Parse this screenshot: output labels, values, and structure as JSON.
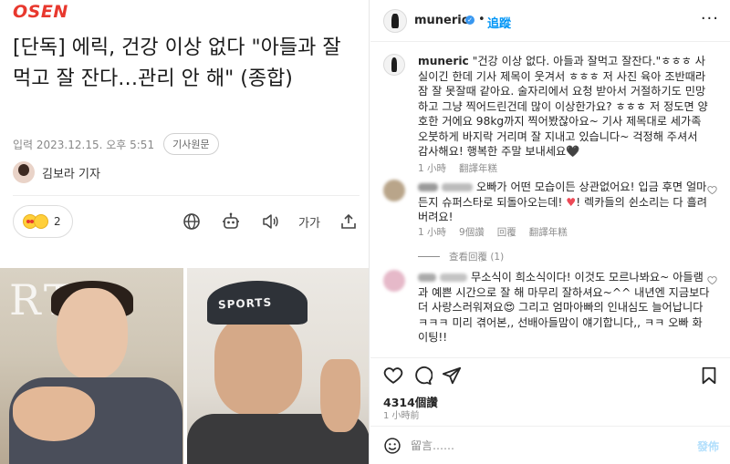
{
  "article": {
    "logo": "OSEN",
    "headline": "[단독] 에릭, 건강 이상 없다 \"아들과 잘 먹고 잘 잔다…관리 안 해\" (종합)",
    "date": "입력 2023.12.15. 오후 5:51",
    "source_button": "기사원문",
    "reporter": "김보라 기자",
    "reaction_count": "2",
    "font_icon_label": "가가",
    "photo_left_text": "RT",
    "photo_right_cap_text": "SPORTS",
    "icons": [
      "globe-icon",
      "robot-icon",
      "speaker-icon",
      "font-size-icon",
      "share-icon"
    ]
  },
  "instagram": {
    "username": "muneric",
    "separator": "•",
    "follow": "追蹤",
    "more": "···",
    "caption": {
      "username": "muneric",
      "text": "\"건강 이상 없다. 아들과 잘먹고 잘잔다.\"ㅎㅎㅎ 사실이긴 한데 기사 제목이 웃겨서 ㅎㅎㅎ 저 사진 육아 조반때라 잠 잘 못잘때 같아요. 술자리에서 요청 받아서 거절하기도 민망하고 그냥 찍어드린건데 많이 이상한가요? ㅎㅎㅎ 저 정도면 양호한 거에요 98kg까지 찍어봤잖아요~ 기사 제목대로 세가족 오붓하게 바지락 거리며 잘 지내고 있습니다~ 걱정해 주셔서 감사해요! 행복한 주말 보내세요",
      "end_emoji": "🖤",
      "time": "1 小時",
      "translate": "翻譯年糕"
    },
    "comments": [
      {
        "text": "오빠가 어떤 모습이든 상관없어요! 입금 후면 얼마든지 슈퍼스타로 되돌아오는데! ",
        "text_end": "! 렉카들의 쉰소리는 다 흘려버려요!",
        "emoji": "♥",
        "time": "1 小時",
        "likes": "9個讚",
        "reply": "回覆",
        "translate": "翻譯年糕",
        "view_replies": "查看回覆 (1)"
      },
      {
        "text": "무소식이 희소식이다! 이것도 모르나봐요~ 아들램과 예쁜 시간으로 잘 해 마무리 잘하셔요~^^ 내년엔 지금보다 더 사랑스러워져요",
        "emoji": "😍",
        "text_end": " 그리고 엄마아빠의 인내심도 늘어납니다ㅋㅋㅋ 미리 겪어본,, 선배아들맘이 얘기합니다,, ㅋㅋ 오빠 화이팅!!"
      }
    ],
    "likes": "4314個讚",
    "posted": "1 小時前",
    "comment_placeholder": "留言……",
    "post_button": "發佈",
    "action_icons": [
      "heart-icon",
      "comment-icon",
      "send-icon",
      "bookmark-icon",
      "emoji-icon"
    ]
  }
}
